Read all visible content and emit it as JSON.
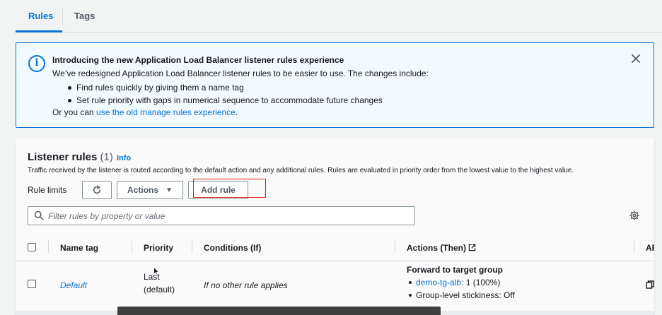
{
  "tabs": [
    {
      "label": "Rules",
      "active": true
    },
    {
      "label": "Tags",
      "active": false
    }
  ],
  "flash": {
    "title": "Introducing the new Application Load Balancer listener rules experience",
    "description": "We’ve redesigned Application Load Balancer listener rules to be easier to use. The changes include:",
    "bullets": [
      "Find rules quickly by giving them a name tag",
      "Set rule priority with gaps in numerical sequence to accommodate future changes"
    ],
    "footer_prefix": "Or you can ",
    "footer_link": "use the old manage rules experience",
    "footer_suffix": ".",
    "info_icon": "info-circle-icon",
    "close_icon": "close-icon"
  },
  "listener_rules": {
    "title": "Listener rules",
    "count": "(1)",
    "info_link": "Info",
    "description": "Traffic received by the listener is routed according to the default action and any additional rules. Rules are evaluated in priority order from the lowest value to the highest value.",
    "rule_limits_label": "Rule limits",
    "actions_label": "Actions",
    "add_rule_label": "Add rule",
    "search_placeholder": "Filter rules by property or value"
  },
  "table": {
    "columns": [
      "Name tag",
      "Priority",
      "Conditions (If)",
      "Actions (Then)",
      "AR"
    ],
    "rows": [
      {
        "name_tag": "Default",
        "priority_line1": "Last",
        "priority_line2": "(default)",
        "conditions": "If no other rule applies",
        "action_title": "Forward to target group",
        "target_link": "demo-tg-alb",
        "target_weight": ": 1 (100%)",
        "stickiness": "Group-level stickiness: Off"
      }
    ]
  },
  "colors": {
    "accent": "#0972d3",
    "flash_bg": "#f1faff",
    "highlight_border": "#e02020"
  }
}
